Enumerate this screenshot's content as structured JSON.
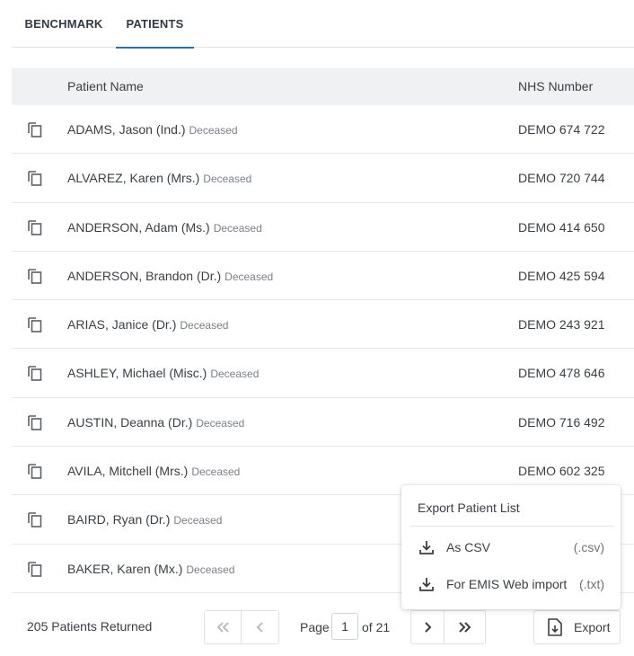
{
  "tabs": [
    {
      "label": "BENCHMARK",
      "active": false
    },
    {
      "label": "PATIENTS",
      "active": true
    }
  ],
  "table": {
    "columns": {
      "name": "Patient Name",
      "nhs": "NHS Number"
    },
    "rows": [
      {
        "name": "ADAMS, Jason (Ind.)",
        "status": "Deceased",
        "nhs": "DEMO 674 722"
      },
      {
        "name": "ALVAREZ, Karen (Mrs.)",
        "status": "Deceased",
        "nhs": "DEMO 720 744"
      },
      {
        "name": "ANDERSON, Adam (Ms.)",
        "status": "Deceased",
        "nhs": "DEMO 414 650"
      },
      {
        "name": "ANDERSON, Brandon (Dr.)",
        "status": "Deceased",
        "nhs": "DEMO 425 594"
      },
      {
        "name": "ARIAS, Janice (Dr.)",
        "status": "Deceased",
        "nhs": "DEMO 243 921"
      },
      {
        "name": "ASHLEY, Michael (Misc.)",
        "status": "Deceased",
        "nhs": "DEMO 478 646"
      },
      {
        "name": "AUSTIN, Deanna (Dr.)",
        "status": "Deceased",
        "nhs": "DEMO 716 492"
      },
      {
        "name": "AVILA, Mitchell (Mrs.)",
        "status": "Deceased",
        "nhs": "DEMO 602 325"
      },
      {
        "name": "BAIRD, Ryan (Dr.)",
        "status": "Deceased",
        "nhs": ""
      },
      {
        "name": "BAKER, Karen (Mx.)",
        "status": "Deceased",
        "nhs": ""
      }
    ]
  },
  "footer": {
    "count_text": "205 Patients Returned",
    "page_label": "Page",
    "page_value": "1",
    "of_label": "of 21",
    "export_label": "Export"
  },
  "export_menu": {
    "title": "Export Patient List",
    "items": [
      {
        "label": "As CSV",
        "ext": "(.csv)",
        "icon": "download-icon"
      },
      {
        "label": "For EMIS Web import",
        "ext": "(.txt)",
        "icon": "download-icon"
      }
    ]
  },
  "colors": {
    "accent": "#2f6fa8",
    "header_bg": "#f0f1f2",
    "text": "#3a3f44",
    "muted": "#7a8088"
  }
}
